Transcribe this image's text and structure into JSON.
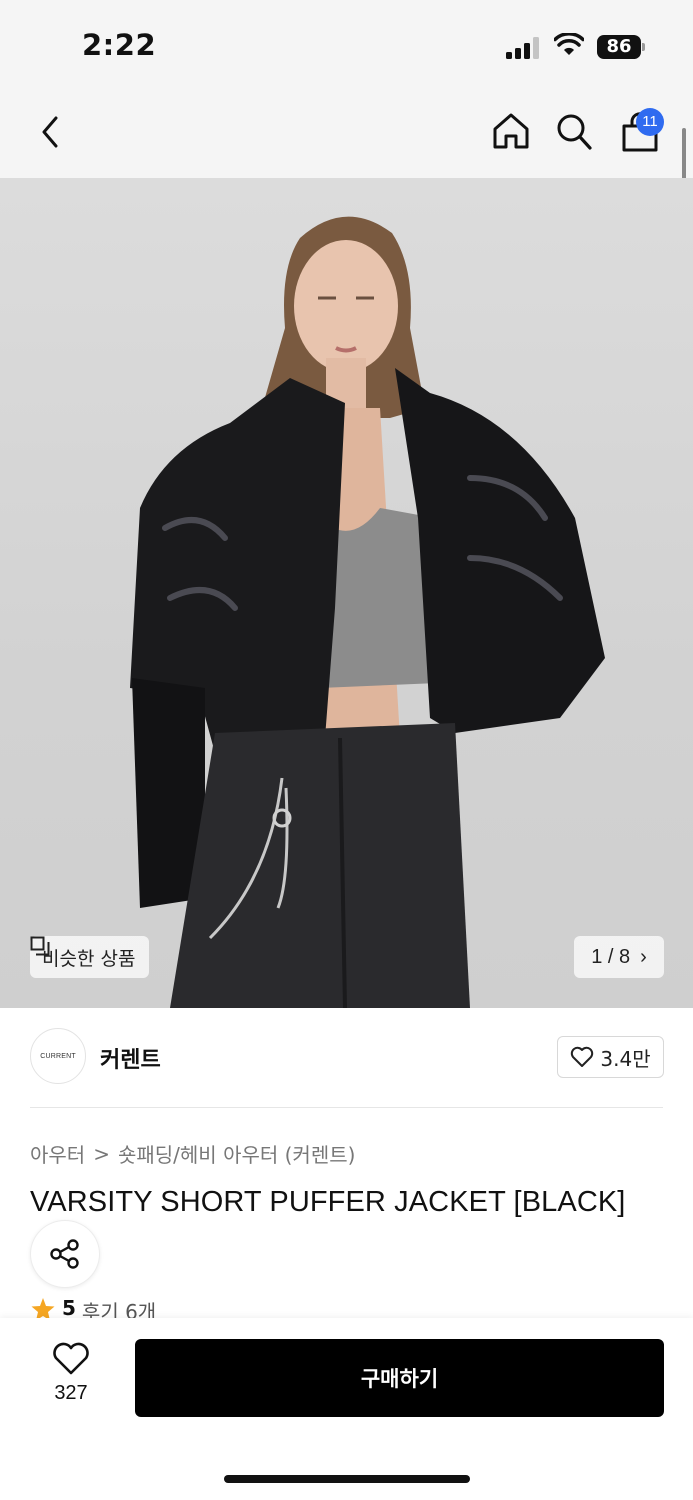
{
  "status_bar": {
    "time": "2:22",
    "battery": "86"
  },
  "nav": {
    "cart_count": "11"
  },
  "gallery": {
    "similar_label": "비슷한 상품",
    "pager": "1 / 8",
    "pager_arrow": "›"
  },
  "brand": {
    "logo_text": "CURRENT",
    "name": "커렌트",
    "likes": "3.4만"
  },
  "product": {
    "category": [
      "아우터",
      "숏패딩/헤비 아우터 (커렌트)"
    ],
    "breadcrumb_separator": ">",
    "title": "VARSITY SHORT PUFFER JACKET [BLACK]",
    "rating": "5",
    "reviews": "후기 6개"
  },
  "bottom": {
    "wish_count": "327",
    "buy_label": "구매하기"
  },
  "colors": {
    "accent_badge": "#2f6bf0",
    "buy_button": "#000000",
    "star": "#f5a623"
  },
  "icons": [
    "back-icon",
    "home-icon",
    "search-icon",
    "cart-icon",
    "similar-icon",
    "heart-icon",
    "share-icon",
    "star-icon"
  ]
}
